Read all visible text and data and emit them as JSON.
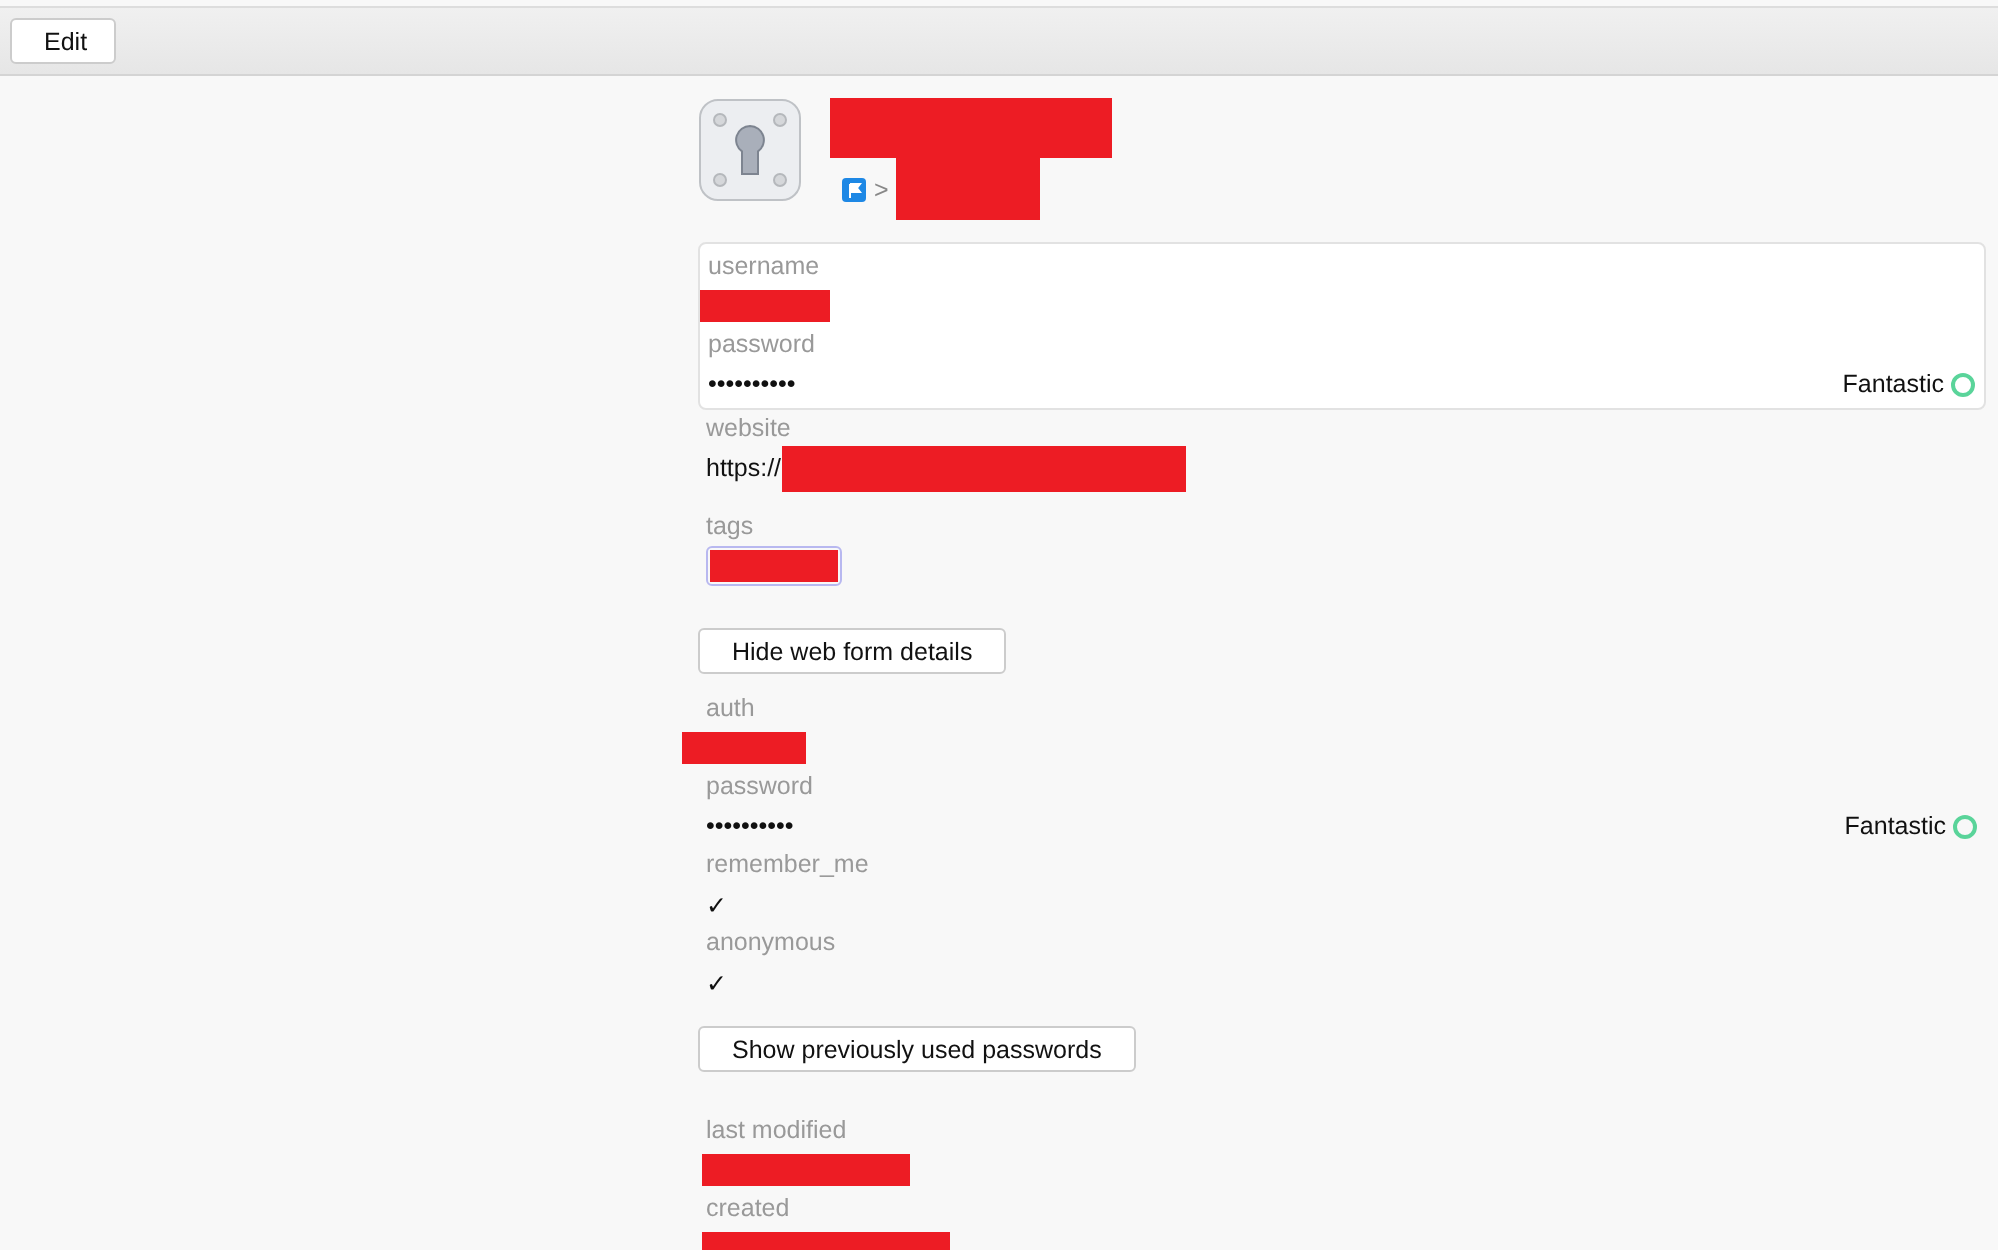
{
  "toolbar": {
    "edit_button": "Edit"
  },
  "item": {
    "title": {
      "redacted": true
    },
    "breadcrumb": {
      "separator": ">",
      "location": {
        "redacted": true
      }
    }
  },
  "main_fields": [
    {
      "label": "username",
      "kind": "text",
      "redacted": true
    },
    {
      "label": "password",
      "kind": "password",
      "value": "••••••••••",
      "strength": "Fantastic"
    }
  ],
  "website": {
    "label": "website",
    "value": "https://",
    "redacted": true
  },
  "tags": {
    "label": "tags",
    "redacted": true
  },
  "web_form_button": "Hide web form details",
  "web_form_fields": [
    {
      "label": "auth",
      "kind": "text",
      "redacted": true
    },
    {
      "label": "password",
      "kind": "password",
      "value": "••••••••••",
      "strength": "Fantastic"
    },
    {
      "label": "remember_me",
      "kind": "text",
      "value": "✓"
    },
    {
      "label": "anonymous",
      "kind": "text",
      "value": "✓"
    }
  ],
  "history_button": "Show previously used passwords",
  "dates": [
    {
      "label": "last modified",
      "redacted": true
    },
    {
      "label": "created",
      "redacted": true
    }
  ]
}
